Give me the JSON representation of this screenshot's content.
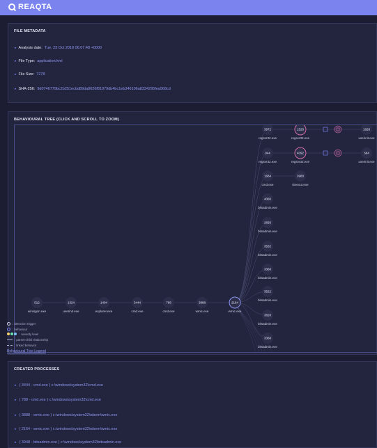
{
  "brand": {
    "name": "REAQTA"
  },
  "file_metadata": {
    "heading": "FILE METADATA",
    "rows": [
      {
        "key": "Analysis date:",
        "value": "Tue, 23 Oct 2018 06:07:48 +0000"
      },
      {
        "key": "File Type:",
        "value": "application/xml"
      },
      {
        "key": "File Size:",
        "value": "7278"
      },
      {
        "key": "SHA-256:",
        "value": "9d0746779bc2b251ecbd89da8626f81979db4bc1eb346106a8334295fea568cd"
      }
    ]
  },
  "tree": {
    "heading": "BEHAVIOURAL TREE (CLICK AND SCROLL TO ZOOM)",
    "chain": [
      {
        "pid": "512",
        "name": "winlogon.exe"
      },
      {
        "pid": "1324",
        "name": "userinit.exe"
      },
      {
        "pid": "1404",
        "name": "explorer.exe"
      },
      {
        "pid": "3444",
        "name": "cmd.exe"
      },
      {
        "pid": "788",
        "name": "cmd.exe"
      },
      {
        "pid": "3888",
        "name": "wmic.exe"
      },
      {
        "pid": "2164",
        "name": "wmic.exe"
      }
    ],
    "children": [
      {
        "pid": "3972",
        "name": "regsvr32.exe"
      },
      {
        "pid": "944",
        "name": "regsvr32.exe"
      },
      {
        "pid": "1684",
        "name": "cmd.exe"
      },
      {
        "pid": "4060",
        "name": "bitsadmin.exe"
      },
      {
        "pid": "2656",
        "name": "bitsadmin.exe"
      },
      {
        "pid": "3532",
        "name": "bitsadmin.exe"
      },
      {
        "pid": "3368",
        "name": "bitsadmin.exe"
      },
      {
        "pid": "3522",
        "name": "bitsadmin.exe"
      },
      {
        "pid": "3828",
        "name": "bitsadmin.exe"
      },
      {
        "pid": "3368",
        "name": "bitsadmin.exe"
      }
    ],
    "grandchildren": [
      {
        "pid": "1520",
        "name": "regsvr32.exe"
      },
      {
        "pid": "4092",
        "name": "regsvr32.exe"
      },
      {
        "pid": "3980",
        "name": "timeout.exe"
      }
    ],
    "leaves": [
      {
        "pid": "1828",
        "name": "userinit.exe"
      },
      {
        "pid": "684",
        "name": "userinit.exe"
      }
    ],
    "legend": [
      {
        "label": ": detection trigger"
      },
      {
        "label": ": behaviour"
      },
      {
        "label": ": severity level"
      },
      {
        "label": ": parent-child relationship"
      },
      {
        "label": ": linked behavior"
      }
    ],
    "legend_link": "Behavioural Tree Legend"
  },
  "created_processes": {
    "heading": "CREATED PROCESSES",
    "rows": [
      "( 3444 - cmd.exe ) c:\\windows\\system32\\cmd.exe",
      "( 788 - cmd.exe ) c:\\windows\\system32\\cmd.exe",
      "( 3888 - wmic.exe ) c:\\windows\\system32\\wbem\\wmic.exe",
      "( 2164 - wmic.exe ) c:\\windows\\system32\\wbem\\wmic.exe",
      "( 3948 - bitsadmin.exe ) c:\\windows\\system32\\bitsadmin.exe"
    ]
  },
  "colors": {
    "accent": "#7b84ee",
    "link": "#8d96f0",
    "highlight_ring": "#d06fa5",
    "severity": [
      "#f3d36b",
      "#6fe3b0",
      "#7ec3f7"
    ]
  }
}
